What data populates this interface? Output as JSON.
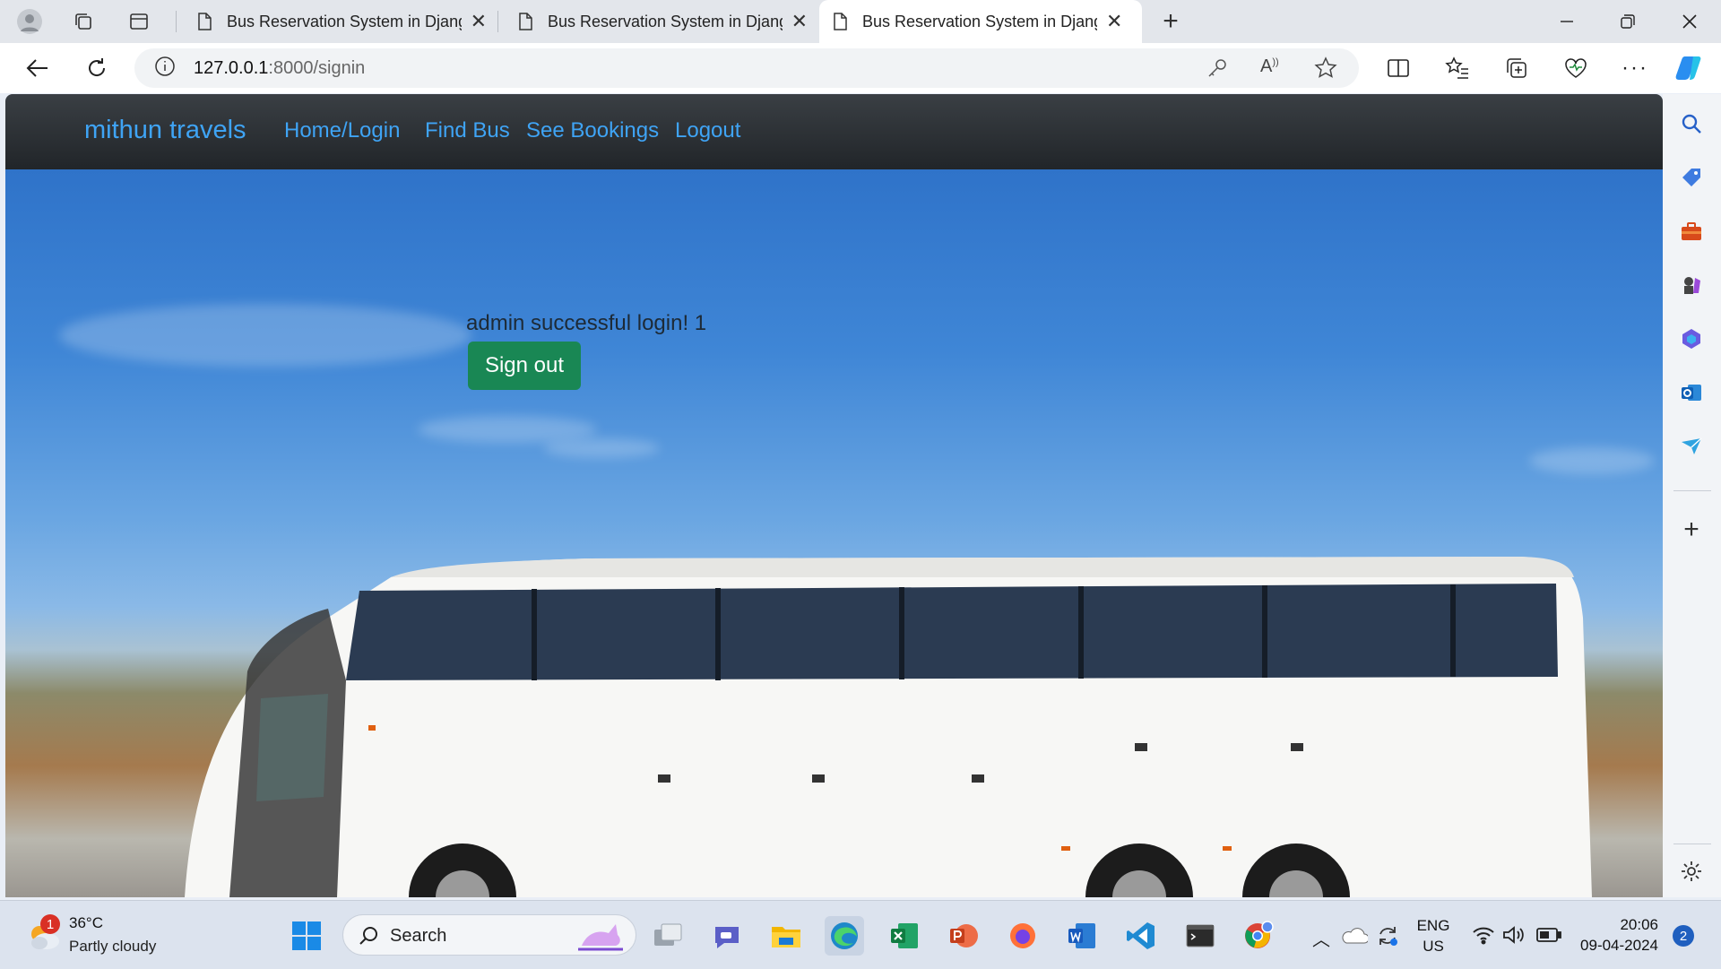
{
  "browser": {
    "tabs": [
      {
        "title": "Bus Reservation System in Django",
        "active": false
      },
      {
        "title": "Bus Reservation System in Django",
        "active": false
      },
      {
        "title": "Bus Reservation System in Django",
        "active": true
      }
    ],
    "url_host": "127.0.0.1",
    "url_path": ":8000/signin"
  },
  "navbar": {
    "brand": "mithun travels",
    "links": [
      "Home/Login",
      "Find Bus",
      "See Bookings",
      "Logout"
    ]
  },
  "main": {
    "message": "admin successful login! 1",
    "signout_label": "Sign out"
  },
  "taskbar": {
    "weather_temp": "36°C",
    "weather_desc": "Partly cloudy",
    "weather_badge": "1",
    "search_label": "Search",
    "lang_top": "ENG",
    "lang_bottom": "US",
    "time": "20:06",
    "date": "09-04-2024",
    "notification_count": "2"
  },
  "colors": {
    "brand_link": "#3fa4f5",
    "navbar_bg": "#212529",
    "signout_bg": "#198754"
  }
}
